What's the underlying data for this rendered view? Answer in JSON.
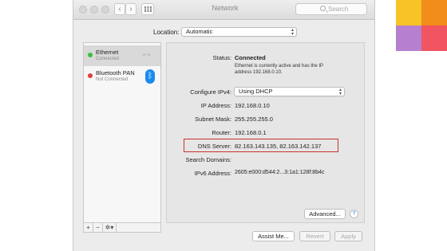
{
  "window": {
    "title": "Network"
  },
  "toolbar": {
    "back": "‹",
    "forward": "›",
    "grid_icon": "grid-icon",
    "search_placeholder": "Search"
  },
  "location": {
    "label": "Location:",
    "value": "Automatic"
  },
  "services": [
    {
      "name": "Ethernet",
      "status": "Connected",
      "status_color": "#3bbf3b",
      "icon": "ethernet-arrows-icon"
    },
    {
      "name": "Bluetooth PAN",
      "status": "Not Connected",
      "status_color": "#e23b3b",
      "icon": "bluetooth-icon"
    }
  ],
  "sidebar_controls": {
    "add": "+",
    "remove": "−",
    "action": "✲▾"
  },
  "detail": {
    "status_label": "Status:",
    "status_value": "Connected",
    "status_desc_1": "Ethernet is currently active and has the IP",
    "status_desc_2": "address 192.168.0.10.",
    "configure_label": "Configure IPv4:",
    "configure_value": "Using DHCP",
    "ip_label": "IP Address:",
    "ip_value": "192.168.0.10",
    "subnet_label": "Subnet Mask:",
    "subnet_value": "255.255.255.0",
    "router_label": "Router:",
    "router_value": "192.168.0.1",
    "dns_label": "DNS Server:",
    "dns_value": "82.163.143.135, 82.163.142.137",
    "search_domains_label": "Search Domains:",
    "ipv6_label": "IPv6 Address:",
    "ipv6_value": "2605:e000:d544:2...3:1a1:128f:8b4c",
    "advanced_button": "Advanced...",
    "help": "?"
  },
  "footer": {
    "assist": "Assist Me...",
    "revert": "Revert",
    "apply": "Apply"
  },
  "colors": {
    "highlight_box": "#c8342c",
    "swatch_yellow": "#f7c325",
    "swatch_orange": "#f28c1b",
    "swatch_purple": "#b77fd0",
    "swatch_red": "#f05561"
  }
}
